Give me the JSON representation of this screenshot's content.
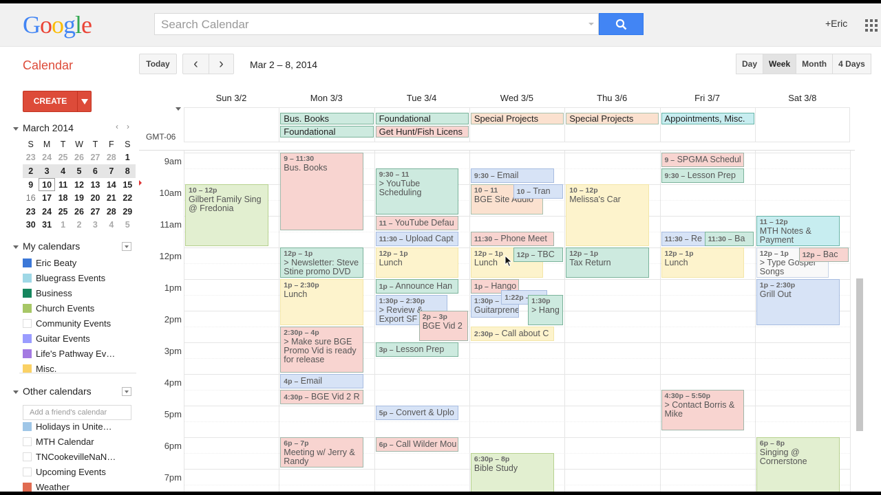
{
  "header": {
    "logo": [
      "G",
      "o",
      "o",
      "g",
      "l",
      "e"
    ],
    "logo_colors": [
      "#4285f4",
      "#ea4335",
      "#fbbc05",
      "#4285f4",
      "#34a853",
      "#ea4335"
    ],
    "search_placeholder": "Search Calendar",
    "user": "+Eric"
  },
  "toolbar": {
    "app_title": "Calendar",
    "today": "Today",
    "prev": "‹",
    "next": "›",
    "date_range": "Mar 2 – 8, 2014",
    "views": [
      "Day",
      "Week",
      "Month",
      "4 Days"
    ],
    "active_view": "Week"
  },
  "sidebar": {
    "create": "CREATE",
    "mini_cal": {
      "title": "March 2014",
      "prev": "‹",
      "next": "›",
      "weekdays": [
        "S",
        "M",
        "T",
        "W",
        "T",
        "F",
        "S"
      ],
      "weeks": [
        [
          "23",
          "24",
          "25",
          "26",
          "27",
          "28",
          "1"
        ],
        [
          "2",
          "3",
          "4",
          "5",
          "6",
          "7",
          "8"
        ],
        [
          "9",
          "10",
          "11",
          "12",
          "13",
          "14",
          "15"
        ],
        [
          "16",
          "17",
          "18",
          "19",
          "20",
          "21",
          "22"
        ],
        [
          "23",
          "24",
          "25",
          "26",
          "27",
          "28",
          "29"
        ],
        [
          "30",
          "31",
          "1",
          "2",
          "3",
          "4",
          "5"
        ]
      ],
      "selected_week": 1,
      "today": "10"
    },
    "my_calendars_title": "My calendars",
    "my_calendars": [
      {
        "name": "Eric Beaty",
        "color": "#3c78d8"
      },
      {
        "name": "Bluegrass Events",
        "color": "#9fd8e6"
      },
      {
        "name": "Business",
        "color": "#16865e"
      },
      {
        "name": "Church Events",
        "color": "#a7c766"
      },
      {
        "name": "Community Events",
        "color": ""
      },
      {
        "name": "Guitar Events",
        "color": "#9a9cff"
      },
      {
        "name": "Life's Pathway Ev…",
        "color": "#a47ae2"
      },
      {
        "name": "Misc.",
        "color": "#fad165"
      }
    ],
    "other_calendars_title": "Other calendars",
    "add_friend_placeholder": "Add a friend's calendar",
    "other_calendars": [
      {
        "name": "Holidays in Unite…",
        "color": "#9fc6e7"
      },
      {
        "name": "MTH Calendar",
        "color": ""
      },
      {
        "name": "TNCookevilleNaN…",
        "color": ""
      },
      {
        "name": "Upcoming Events",
        "color": ""
      },
      {
        "name": "Weather",
        "color": "#e06b51"
      }
    ]
  },
  "week": {
    "timezone": "GMT-06",
    "days": [
      "Sun 3/2",
      "Mon 3/3",
      "Tue 3/4",
      "Wed 3/5",
      "Thu 3/6",
      "Fri 3/7",
      "Sat 3/8"
    ],
    "hours": [
      "9am",
      "10am",
      "11am",
      "12pm",
      "1pm",
      "2pm",
      "3pm",
      "4pm",
      "5pm",
      "6pm",
      "7pm"
    ],
    "allday": [
      {
        "day": 1,
        "row": 0,
        "title": "Bus. Books",
        "color": "teal"
      },
      {
        "day": 1,
        "row": 1,
        "title": "Foundational",
        "color": "teal"
      },
      {
        "day": 2,
        "row": 0,
        "title": "Foundational",
        "color": "teal"
      },
      {
        "day": 2,
        "row": 1,
        "title": "Get Hunt/Fish Licens",
        "color": "red"
      },
      {
        "day": 3,
        "row": 0,
        "title": "Special Projects",
        "color": "peach"
      },
      {
        "day": 4,
        "row": 0,
        "title": "Special Projects",
        "color": "peach"
      },
      {
        "day": 5,
        "row": 0,
        "title": "Appointments, Misc.",
        "color": "cyan"
      }
    ],
    "events": [
      {
        "day": 0,
        "start": 10,
        "end": 12,
        "time": "10 – 12p",
        "title": "Gilbert Family Sing @ Fredonia",
        "color": "green"
      },
      {
        "day": 1,
        "start": 9,
        "end": 11.5,
        "time": "9 – 11:30",
        "title": "Bus. Books",
        "color": "red"
      },
      {
        "day": 1,
        "start": 12,
        "end": 13,
        "time": "12p – 1p",
        "title": "> Newsletter: Steve Stine promo DVD",
        "color": "teal"
      },
      {
        "day": 1,
        "start": 13,
        "end": 14.5,
        "time": "1p – 2:30p",
        "title": "Lunch",
        "color": "yellow"
      },
      {
        "day": 1,
        "start": 14.5,
        "end": 16,
        "time": "2:30p – 4p",
        "title": "> Make sure BGE Promo Vid is ready for release",
        "color": "red"
      },
      {
        "day": 1,
        "start": 16,
        "end": 16.5,
        "time": "4p –",
        "title": "Email",
        "color": "blue",
        "single": true
      },
      {
        "day": 1,
        "start": 16.5,
        "end": 17,
        "time": "4:30p –",
        "title": "BGE Vid 2 R",
        "color": "red",
        "single": true
      },
      {
        "day": 1,
        "start": 18,
        "end": 19,
        "time": "6p – 7p",
        "title": "Meeting w/ Jerry & Randy",
        "color": "red"
      },
      {
        "day": 2,
        "start": 9.5,
        "end": 11,
        "time": "9:30 – 11",
        "title": "> YouTube Scheduling",
        "color": "teal"
      },
      {
        "day": 2,
        "start": 11,
        "end": 11.5,
        "time": "11 –",
        "title": "YouTube Defau",
        "color": "red",
        "single": true
      },
      {
        "day": 2,
        "start": 11.5,
        "end": 12,
        "time": "11:30 –",
        "title": "Upload Capt",
        "color": "blue",
        "single": true
      },
      {
        "day": 2,
        "start": 12,
        "end": 13,
        "time": "12p – 1p",
        "title": "Lunch",
        "color": "yellow"
      },
      {
        "day": 2,
        "start": 13,
        "end": 13.5,
        "time": "1p –",
        "title": "Announce Han",
        "color": "teal",
        "single": true
      },
      {
        "day": 2,
        "start": 13.5,
        "end": 14.5,
        "time": "1:30p – 2:30p",
        "title": "> Review & Export SF",
        "color": "blue",
        "w": 0.78
      },
      {
        "day": 2,
        "start": 14,
        "end": 15,
        "time": "2p – 3p",
        "title": "BGE Vid 2",
        "color": "red",
        "x": 0.47,
        "w": 0.53
      },
      {
        "day": 2,
        "start": 15,
        "end": 15.5,
        "time": "3p –",
        "title": "Lesson Prep",
        "color": "teal",
        "single": true
      },
      {
        "day": 2,
        "start": 17,
        "end": 17.5,
        "time": "5p –",
        "title": "Convert & Uplo",
        "color": "blue",
        "single": true
      },
      {
        "day": 2,
        "start": 18,
        "end": 18.5,
        "time": "6p –",
        "title": "Call Wilder Mou",
        "color": "red",
        "single": true
      },
      {
        "day": 3,
        "start": 9.5,
        "end": 10,
        "time": "9:30 –",
        "title": "Email",
        "color": "blue",
        "single": true
      },
      {
        "day": 3,
        "start": 10,
        "end": 11,
        "time": "10 – 11",
        "title": "BGE Site Audio",
        "color": "peach",
        "w": 0.78
      },
      {
        "day": 3,
        "start": 10,
        "end": 10.5,
        "time": "10 –",
        "title": "Tran",
        "color": "blue",
        "single": true,
        "x": 0.46,
        "w": 0.54
      },
      {
        "day": 3,
        "start": 11.5,
        "end": 12,
        "time": "11:30 –",
        "title": "Phone Meet",
        "color": "red",
        "single": true
      },
      {
        "day": 3,
        "start": 12,
        "end": 13,
        "time": "12p – 1p",
        "title": "Lunch",
        "color": "yellow",
        "w": 0.78
      },
      {
        "day": 3,
        "start": 12,
        "end": 12.5,
        "time": "12p –",
        "title": "TBC",
        "color": "teal",
        "single": true,
        "x": 0.46,
        "w": 0.54
      },
      {
        "day": 3,
        "start": 13,
        "end": 13.5,
        "time": "1p –",
        "title": "Hango",
        "color": "red",
        "single": true,
        "w": 0.52
      },
      {
        "day": 3,
        "start": 13.5,
        "end": 14.25,
        "time": "1:30p –",
        "title": "Guitarpreneur",
        "color": "blue",
        "w": 0.52
      },
      {
        "day": 3,
        "start": 13.35,
        "end": 13.85,
        "time": "1:22p –",
        "title": "",
        "color": "blue",
        "single": true,
        "x": 0.33,
        "w": 0.5
      },
      {
        "day": 3,
        "start": 13.5,
        "end": 14.5,
        "time": "1:30p",
        "title": "> Hang",
        "color": "teal",
        "x": 0.62,
        "w": 0.38
      },
      {
        "day": 3,
        "start": 14.5,
        "end": 15,
        "time": "2:30p –",
        "title": "Call about C",
        "color": "yellow",
        "single": true
      },
      {
        "day": 3,
        "start": 18.5,
        "end": 20,
        "time": "6:30p – 8p",
        "title": "Bible Study",
        "color": "green"
      },
      {
        "day": 4,
        "start": 10,
        "end": 12,
        "time": "10 – 12p",
        "title": "Melissa's Car",
        "color": "yellow"
      },
      {
        "day": 4,
        "start": 12,
        "end": 13,
        "time": "12p – 1p",
        "title": "Tax Return",
        "color": "teal"
      },
      {
        "day": 5,
        "start": 9,
        "end": 9.5,
        "time": "9 –",
        "title": "SPGMA Schedul",
        "color": "red",
        "single": true
      },
      {
        "day": 5,
        "start": 9.5,
        "end": 10,
        "time": "9:30 –",
        "title": "Lesson Prep",
        "color": "teal",
        "single": true
      },
      {
        "day": 5,
        "start": 11.5,
        "end": 12,
        "time": "11:30 –",
        "title": "Re",
        "color": "blue",
        "single": true,
        "w": 0.5
      },
      {
        "day": 5,
        "start": 11.5,
        "end": 12,
        "time": "11:30 –",
        "title": "Ba",
        "color": "teal",
        "single": true,
        "x": 0.47,
        "w": 0.53
      },
      {
        "day": 5,
        "start": 12,
        "end": 13,
        "time": "12p – 1p",
        "title": "Lunch",
        "color": "yellow"
      },
      {
        "day": 5,
        "start": 16.5,
        "end": 17.83,
        "time": "4:30p – 5:50p",
        "title": "> Contact Borris & Mike",
        "color": "red"
      },
      {
        "day": 6,
        "start": 11,
        "end": 12,
        "time": "11 – 12p",
        "title": "MTH Notes & Payment",
        "color": "cyan"
      },
      {
        "day": 6,
        "start": 12,
        "end": 13,
        "time": "12p – 1p",
        "title": "> Type Gospel Songs",
        "color": "white",
        "w": 0.78
      },
      {
        "day": 6,
        "start": 12,
        "end": 12.5,
        "time": "12p –",
        "title": "Bac",
        "color": "red",
        "single": true,
        "x": 0.46,
        "w": 0.54
      },
      {
        "day": 6,
        "start": 13,
        "end": 14.5,
        "time": "1p – 2:30p",
        "title": "Grill Out",
        "color": "blue"
      },
      {
        "day": 6,
        "start": 18,
        "end": 20,
        "time": "6p – 8p",
        "title": "Singing @ Cornerstone",
        "color": "green"
      }
    ]
  }
}
